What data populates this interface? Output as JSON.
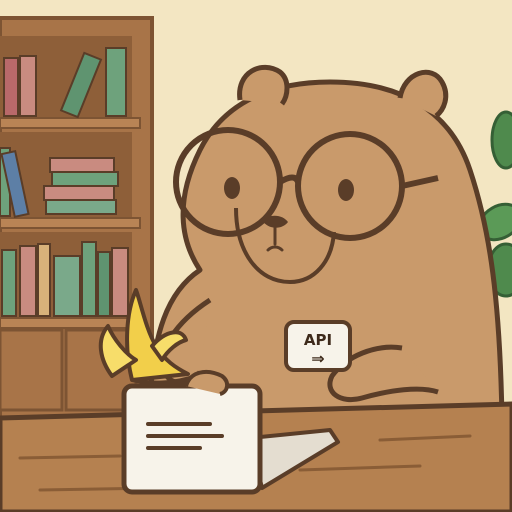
{
  "scene": {
    "subject": "capybara-with-glasses",
    "props": [
      "bookshelf",
      "banana",
      "laptop",
      "api-card",
      "houseplant"
    ]
  },
  "api_card": {
    "label": "API",
    "arrow": "⇒"
  },
  "colors": {
    "wall": "#f3e6c2",
    "capybara": "#c99a6b",
    "capybara_shade": "#b88a5c",
    "outline": "#5a3d28",
    "shelf": "#a87448",
    "shelf_dark": "#7d5433",
    "desk": "#b58150",
    "banana": "#f2cf4a",
    "laptop": "#f7f3ea",
    "plant": "#4f8a4d"
  }
}
